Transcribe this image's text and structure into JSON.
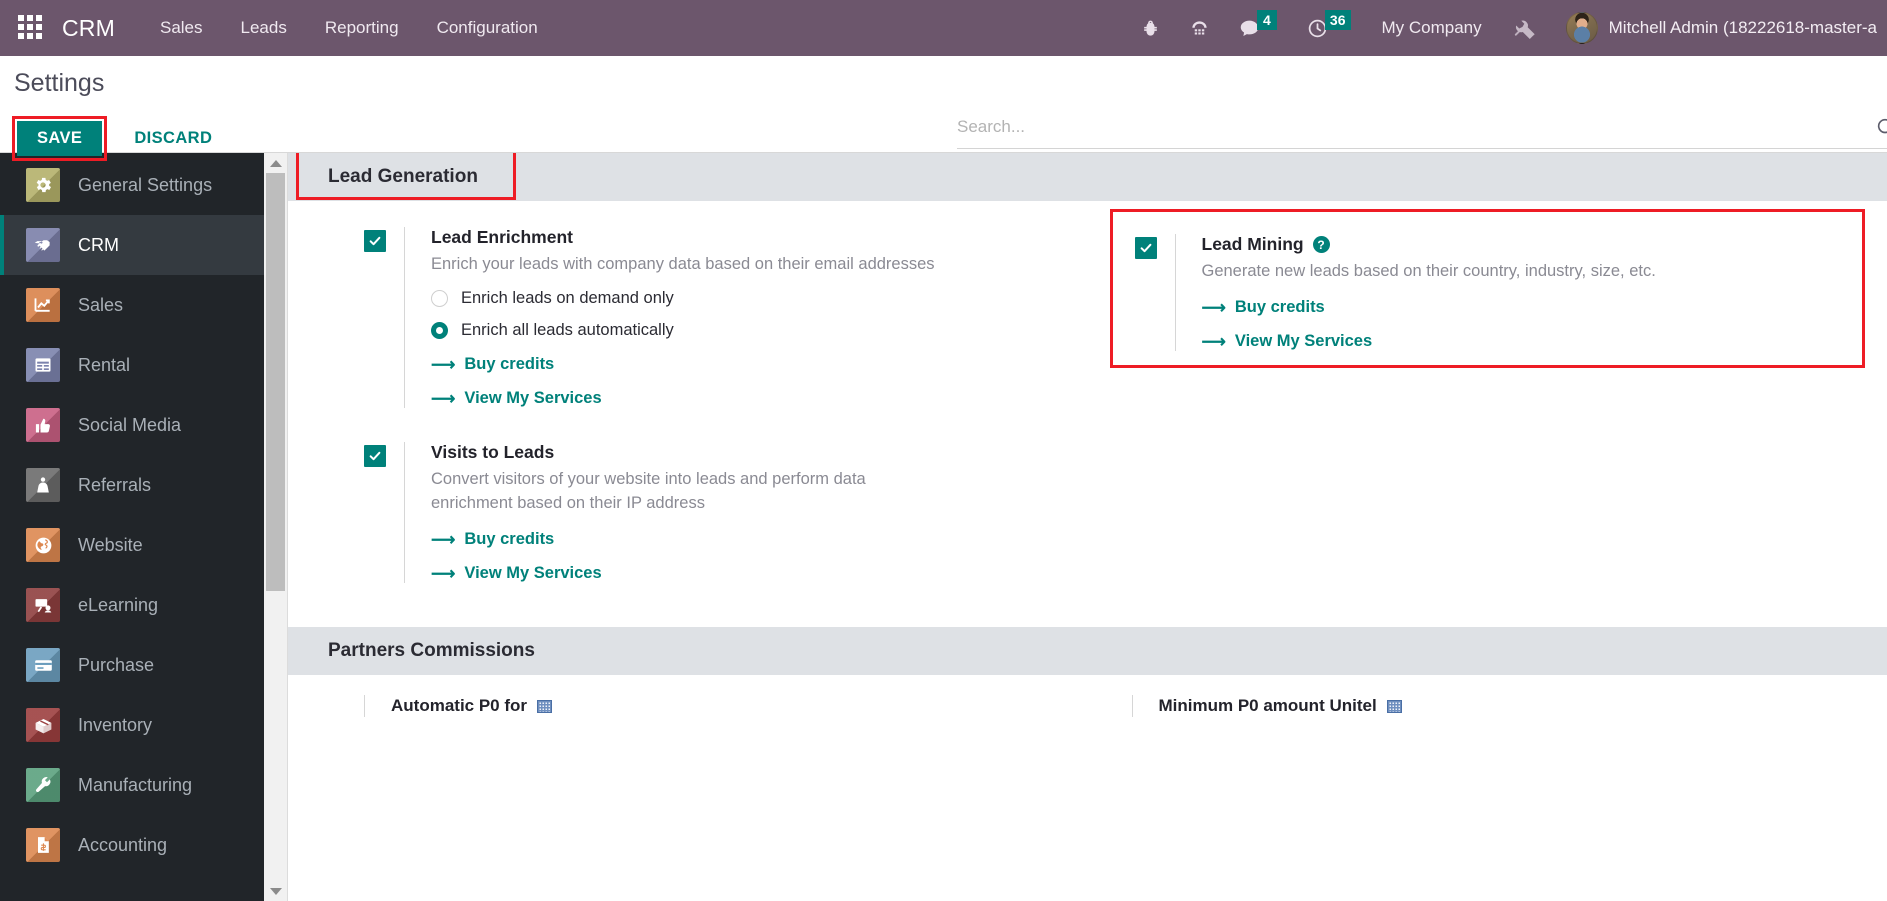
{
  "navbar": {
    "apps_icon": "apps-grid-icon",
    "brand": "CRM",
    "menu": [
      {
        "label": "Sales"
      },
      {
        "label": "Leads"
      },
      {
        "label": "Reporting"
      },
      {
        "label": "Configuration"
      }
    ],
    "icons": [
      {
        "name": "bug-icon",
        "badge": null
      },
      {
        "name": "dialpad-icon",
        "badge": null
      },
      {
        "name": "messages-icon",
        "badge": "4"
      },
      {
        "name": "activities-clock-icon",
        "badge": "36"
      }
    ],
    "company": "My Company",
    "tools_icon": "tools-icon",
    "user_name": "Mitchell Admin (18222618-master-a",
    "accent": "#00817a",
    "background": "#6c566c"
  },
  "control_panel": {
    "title": "Settings",
    "save_label": "SAVE",
    "discard_label": "DISCARD",
    "search_placeholder": "Search...",
    "search_icon": "search-icon"
  },
  "sidebar": {
    "items": [
      {
        "label": "General Settings",
        "icon": "gear-icon",
        "color": "#b3b06a",
        "active": false
      },
      {
        "label": "CRM",
        "icon": "handshake-icon",
        "color": "#7b7fa8",
        "active": true
      },
      {
        "label": "Sales",
        "icon": "chart-up-icon",
        "color": "#d9824a",
        "active": false
      },
      {
        "label": "Rental",
        "icon": "calendar-icon",
        "color": "#7b82ac",
        "active": false
      },
      {
        "label": "Social Media",
        "icon": "thumbs-up-icon",
        "color": "#c85f82",
        "active": false
      },
      {
        "label": "Referrals",
        "icon": "people-icon",
        "color": "#6b6b6b",
        "active": false
      },
      {
        "label": "Website",
        "icon": "globe-icon",
        "color": "#dd8850",
        "active": false
      },
      {
        "label": "eLearning",
        "icon": "presentation-icon",
        "color": "#8e3f3f",
        "active": false
      },
      {
        "label": "Purchase",
        "icon": "credit-card-icon",
        "color": "#6b9dbd",
        "active": false
      },
      {
        "label": "Inventory",
        "icon": "box-icon",
        "color": "#9c3f3f",
        "active": false
      },
      {
        "label": "Manufacturing",
        "icon": "wrench-icon",
        "color": "#5aa17e",
        "active": false
      },
      {
        "label": "Accounting",
        "icon": "invoice-icon",
        "color": "#dd8850",
        "active": false
      }
    ]
  },
  "sections": {
    "lead_generation": {
      "header": "Lead Generation",
      "header_highlighted": true,
      "left_blocks": [
        {
          "id": "lead-enrichment",
          "title": "Lead Enrichment",
          "checked": true,
          "description": "Enrich your leads with company data based on their email addresses",
          "help": false,
          "radios": [
            {
              "label": "Enrich leads on demand only",
              "selected": false
            },
            {
              "label": "Enrich all leads automatically",
              "selected": true
            }
          ],
          "links": [
            {
              "label": "Buy credits"
            },
            {
              "label": "View My Services"
            }
          ]
        },
        {
          "id": "visits-to-leads",
          "title": "Visits to Leads",
          "checked": true,
          "description": "Convert visitors of your website into leads and perform data enrichment based on their IP address",
          "help": false,
          "radios": [],
          "links": [
            {
              "label": "Buy credits"
            },
            {
              "label": "View My Services"
            }
          ]
        }
      ],
      "right_blocks": [
        {
          "id": "lead-mining",
          "title": "Lead Mining",
          "checked": true,
          "highlighted": true,
          "description": "Generate new leads based on their country, industry, size, etc.",
          "help": true,
          "help_glyph": "?",
          "radios": [],
          "links": [
            {
              "label": "Buy credits"
            },
            {
              "label": "View My Services"
            }
          ]
        }
      ]
    },
    "partners_commissions": {
      "header": "Partners Commissions",
      "left_stub": "Automatic P0 for",
      "right_stub": "Minimum P0 amount Unitel"
    }
  },
  "colors": {
    "accent_teal": "#00817a",
    "annotation_red": "#ee1c25",
    "navbar_purple": "#6c566c",
    "section_gray": "#dee1e5",
    "sidebar_dark": "#212529"
  }
}
